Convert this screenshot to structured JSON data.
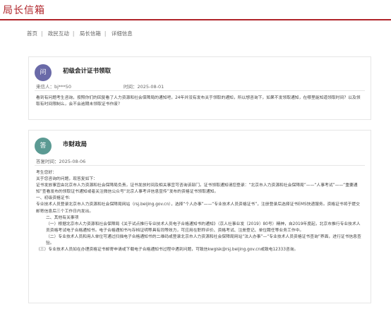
{
  "header": {
    "title": "局长信箱"
  },
  "breadcrumb": [
    "首页",
    "政民互动",
    "局长信箱",
    "详细信息"
  ],
  "question": {
    "badge": "问",
    "title": "初级会计证书领取",
    "sender": "来信人：bj***50",
    "time": "时间：2025-08-01",
    "content": "看到有问题考生咨询，按照你们的回复看了人力资源和社会保障局的通知吧，24年并没有发布关于领取的通知，所以想咨询下，如果不发领取通知，在哪里能知道领取时间？以及领取有时间限制么，会不会逾期未领取证书作废？"
  },
  "answer": {
    "badge": "答",
    "title": "市财政局",
    "time": "答复时间：2025-08-06",
    "lines": [
      "考生您好：",
      "关于您咨询的问题，现答复如下：",
      "证书发放事宜由北京市人力资源和社会保障局负责，证书发放时间及相关事宜可咨询该部门。证书领取通知请您登录：“北京市人力资源和社会保障局”——“人事考试”——“重要通知”查看发布的领取证书通知或者关注微信公众号“北京人事考评信息宣传”发布的资格证书领取通知。",
      "一、初级资格证书:",
      "专业技术人员登录北京市人力资源和社会保障局网站（rsj.beijing.gov.cn），选择“个人办事”——“专业技术人员资格证书”，注册登录后选择证书EMS快递服务。资格证书将于提交邮寄信息后三个工作日内发出。",
      "二、其他有关事项",
      "（一）根据北京市人力资源和社会保障局《关于试点推行专业技术人员电子合格通知书的通知》（京人社事业发〔2019〕80号）精神，自2019年度起，北京市推行专业技术人员资格考试电子合格通知书。电子合格通知书与存档证明等具有同等效力，可应用在职称评价、资格考试、注册登记、单位聘任等业务工作中。",
      "（二）专业技术人员和用人单位可通过扫描电子合格通知书的二维码或登录北京市人力资源和社会保障局网站“法人办事”—“专业技术人员资格证书查询”界面，进行证书信息查验。",
      "（三）专业技术人员如在办理资格证书邮寄申请或下载电子合格通知书过程中遇到问题，可致信kwglsk@rsj.beijing.gov.cn或致电12333咨询。"
    ]
  }
}
